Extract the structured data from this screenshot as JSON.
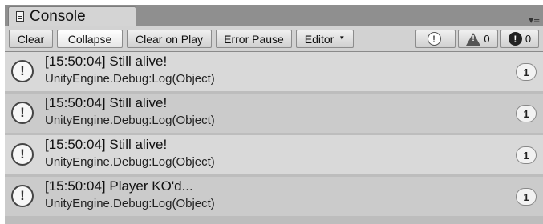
{
  "window": {
    "tab_title": "Console",
    "tab_menu_glyph": "▾≡"
  },
  "toolbar": {
    "clear": "Clear",
    "collapse": "Collapse",
    "clear_on_play": "Clear on Play",
    "error_pause": "Error Pause",
    "editor": "Editor",
    "info_count": "",
    "warning_count": "0",
    "error_count": "0"
  },
  "logs": [
    {
      "time": "[15:50:04]",
      "message": "Still alive!",
      "trace": "UnityEngine.Debug:Log(Object)",
      "count": "1"
    },
    {
      "time": "[15:50:04]",
      "message": "Still alive!",
      "trace": "UnityEngine.Debug:Log(Object)",
      "count": "1"
    },
    {
      "time": "[15:50:04]",
      "message": "Still alive!",
      "trace": "UnityEngine.Debug:Log(Object)",
      "count": "1"
    },
    {
      "time": "[15:50:04]",
      "message": "Player KO'd...",
      "trace": "UnityEngine.Debug:Log(Object)",
      "count": "1"
    }
  ],
  "icons": {
    "tab": "console-icon",
    "info": "info-icon",
    "warning": "warning-icon",
    "error": "error-icon"
  }
}
